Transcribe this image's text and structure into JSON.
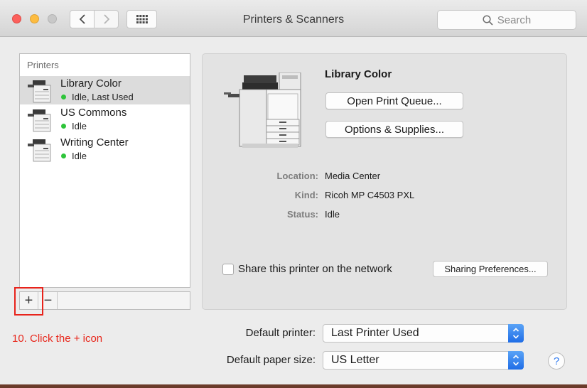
{
  "window": {
    "title": "Printers & Scanners",
    "search_placeholder": "Search"
  },
  "printers_list": {
    "header": "Printers",
    "items": [
      {
        "name": "Library Color",
        "status": "Idle, Last Used",
        "selected": true
      },
      {
        "name": "US Commons",
        "status": "Idle",
        "selected": false
      },
      {
        "name": "Writing Center",
        "status": "Idle",
        "selected": false
      }
    ],
    "add_label": "+",
    "remove_label": "−"
  },
  "instruction": "10. Click the + icon",
  "details": {
    "name": "Library Color",
    "open_queue_label": "Open Print Queue...",
    "options_label": "Options & Supplies...",
    "location_label": "Location:",
    "location_value": "Media Center",
    "kind_label": "Kind:",
    "kind_value": "Ricoh MP C4503 PXL",
    "status_label": "Status:",
    "status_value": "Idle",
    "share_label": "Share this printer on the network",
    "share_checked": false,
    "sharing_prefs_label": "Sharing Preferences..."
  },
  "defaults": {
    "printer_label": "Default printer:",
    "printer_value": "Last Printer Used",
    "paper_label": "Default paper size:",
    "paper_value": "US Letter"
  },
  "help_label": "?",
  "colors": {
    "status_dot": "#2ec43a",
    "annotation_red": "#e8231b",
    "select_accent": "#1f6de6"
  }
}
